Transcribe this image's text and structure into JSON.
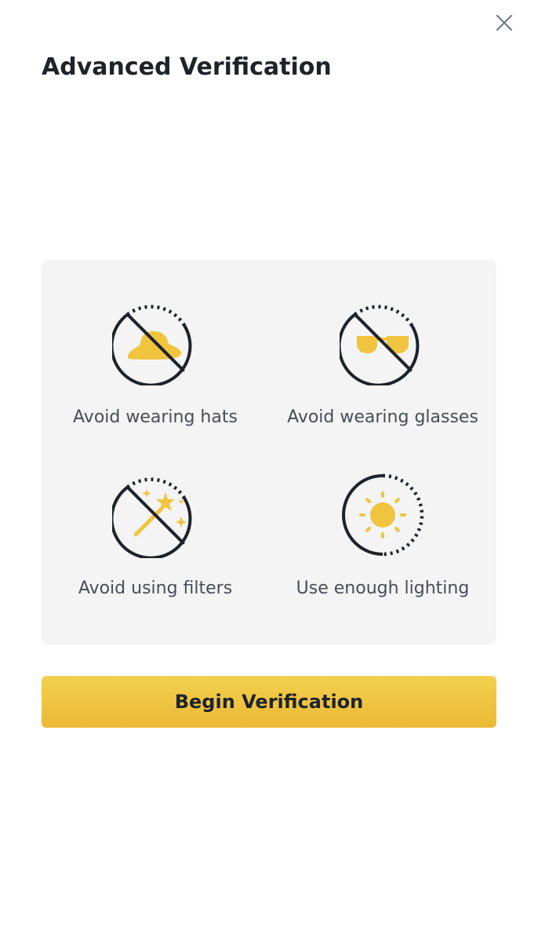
{
  "header": {
    "title": "Advanced Verification",
    "close_icon": "close-icon"
  },
  "tips": [
    {
      "label": "Avoid wearing hats",
      "icon": "no-hat-icon"
    },
    {
      "label": "Avoid wearing glasses",
      "icon": "no-glasses-icon"
    },
    {
      "label": "Avoid using filters",
      "icon": "no-filter-icon"
    },
    {
      "label": "Use enough lighting",
      "icon": "lighting-icon"
    }
  ],
  "actions": {
    "begin_label": "Begin Verification"
  },
  "colors": {
    "accent": "#f0c43f",
    "icon_stroke": "#1e2329",
    "panel_bg": "#f4f4f4",
    "label_text": "#474d57"
  }
}
